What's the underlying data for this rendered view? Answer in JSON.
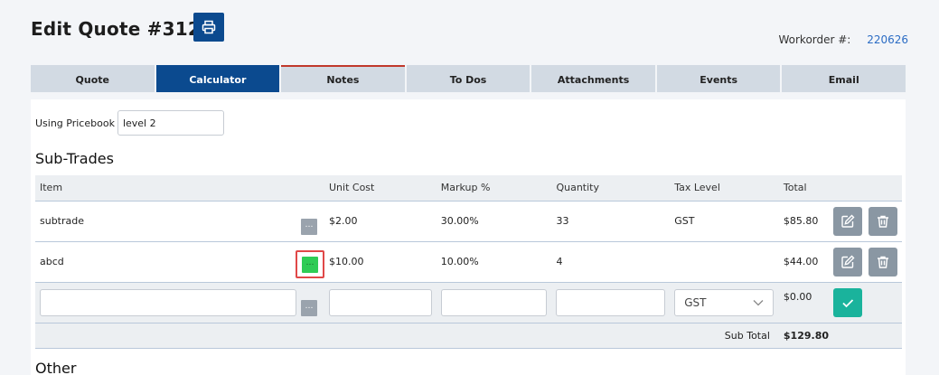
{
  "header": {
    "title": "Edit Quote #3120",
    "workorder_label": "Workorder #:",
    "workorder_value": "220626"
  },
  "tabs": [
    {
      "label": "Quote"
    },
    {
      "label": "Calculator"
    },
    {
      "label": "Notes"
    },
    {
      "label": "To Dos"
    },
    {
      "label": "Attachments"
    },
    {
      "label": "Events"
    },
    {
      "label": "Email"
    }
  ],
  "pricebook": {
    "label": "Using Pricebook",
    "value": "level 2"
  },
  "sections": {
    "subtrades": "Sub-Trades",
    "other": "Other"
  },
  "table": {
    "columns": [
      "Item",
      "Unit Cost",
      "Markup %",
      "Quantity",
      "Tax Level",
      "Total"
    ],
    "rows": [
      {
        "item": "subtrade",
        "unit_cost": "$2.00",
        "markup": "30.00%",
        "quantity": "33",
        "tax": "GST",
        "total": "$85.80"
      },
      {
        "item": "abcd",
        "unit_cost": "$10.00",
        "markup": "10.00%",
        "quantity": "4",
        "tax": "",
        "total": "$44.00"
      }
    ],
    "new_row": {
      "tax_selected": "GST",
      "total": "$0.00"
    },
    "subtotal_label": "Sub Total",
    "subtotal_value": "$129.80"
  },
  "icons": {
    "print": "print-icon",
    "edit": "edit-icon",
    "delete": "trash-icon",
    "confirm": "check-icon",
    "more": "ellipsis-icon"
  },
  "colors": {
    "primary": "#0b4a8f",
    "highlight": "#2ecc55",
    "success": "#1ab39c",
    "link": "#2b6cc4"
  }
}
